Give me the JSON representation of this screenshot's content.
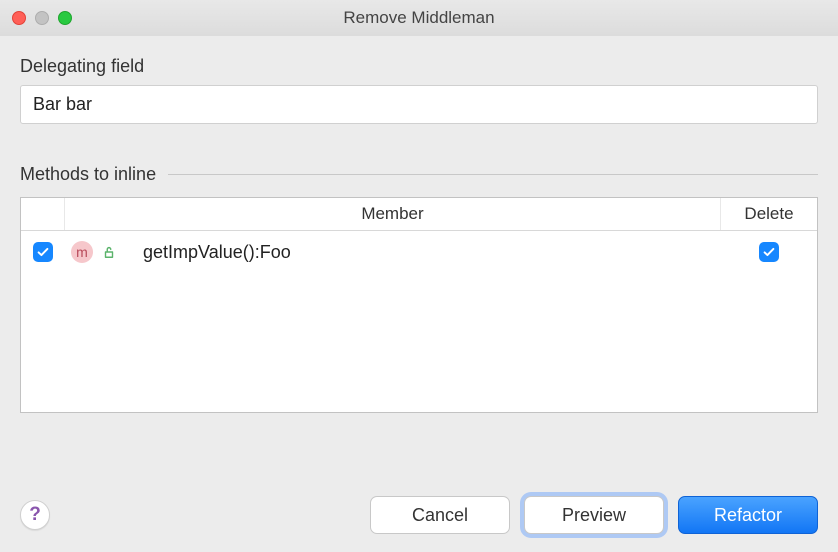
{
  "titlebar": {
    "title": "Remove Middleman"
  },
  "delegating": {
    "label": "Delegating field",
    "value": "Bar bar"
  },
  "methods": {
    "section_label": "Methods to inline",
    "columns": {
      "member": "Member",
      "delete": "Delete"
    },
    "rows": [
      {
        "icon_glyph": "m",
        "member": "getImpValue():Foo"
      }
    ]
  },
  "footer": {
    "help": "?",
    "cancel": "Cancel",
    "preview": "Preview",
    "refactor": "Refactor"
  }
}
